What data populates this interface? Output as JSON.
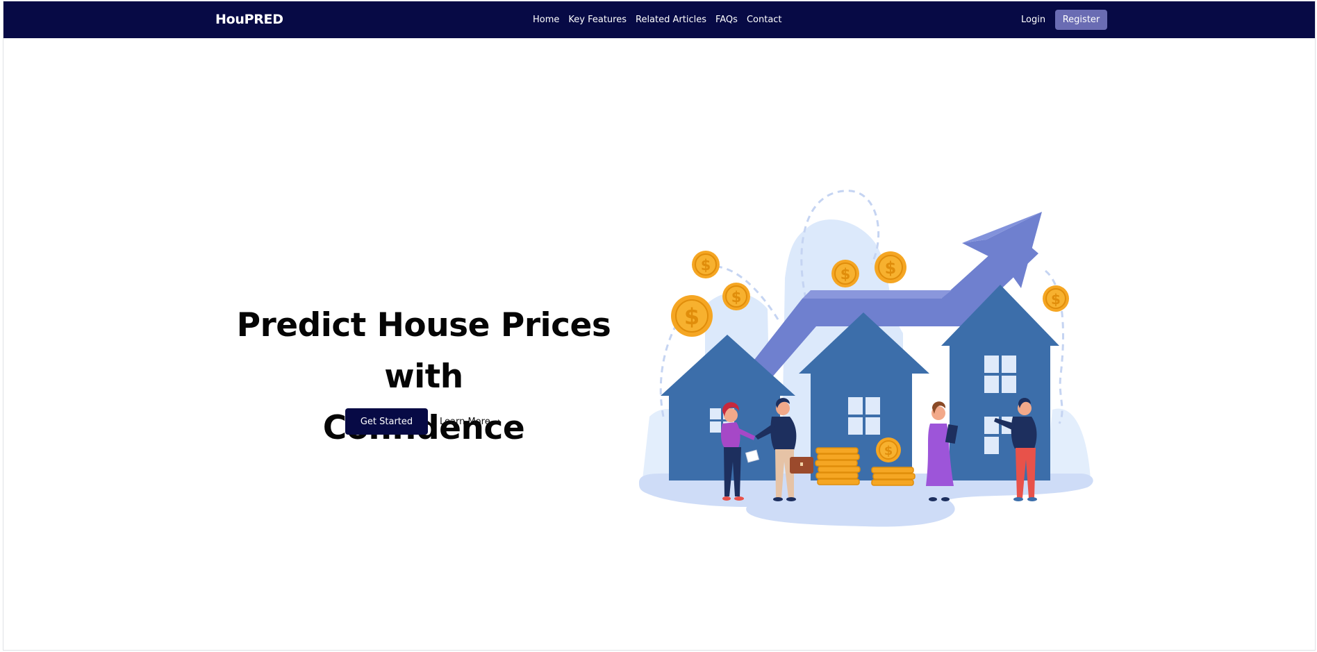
{
  "brand": "HouPRED",
  "nav": {
    "links": [
      "Home",
      "Key Features",
      "Related Articles",
      "FAQs",
      "Contact"
    ],
    "login": "Login",
    "register": "Register"
  },
  "hero": {
    "title_line1": "Predict House Prices with",
    "title_line2": "Confidence",
    "primary_cta": "Get Started",
    "secondary_cta": "Learn More →"
  },
  "colors": {
    "navbar": "#070a45",
    "register_button": "#6a6cb3",
    "primary_button": "#070a45",
    "house": "#3c6eaa",
    "arrow": "#6f7fcf",
    "coin": "#f5a623"
  },
  "illustration": {
    "icon": "houses-price-growth-illustration"
  }
}
